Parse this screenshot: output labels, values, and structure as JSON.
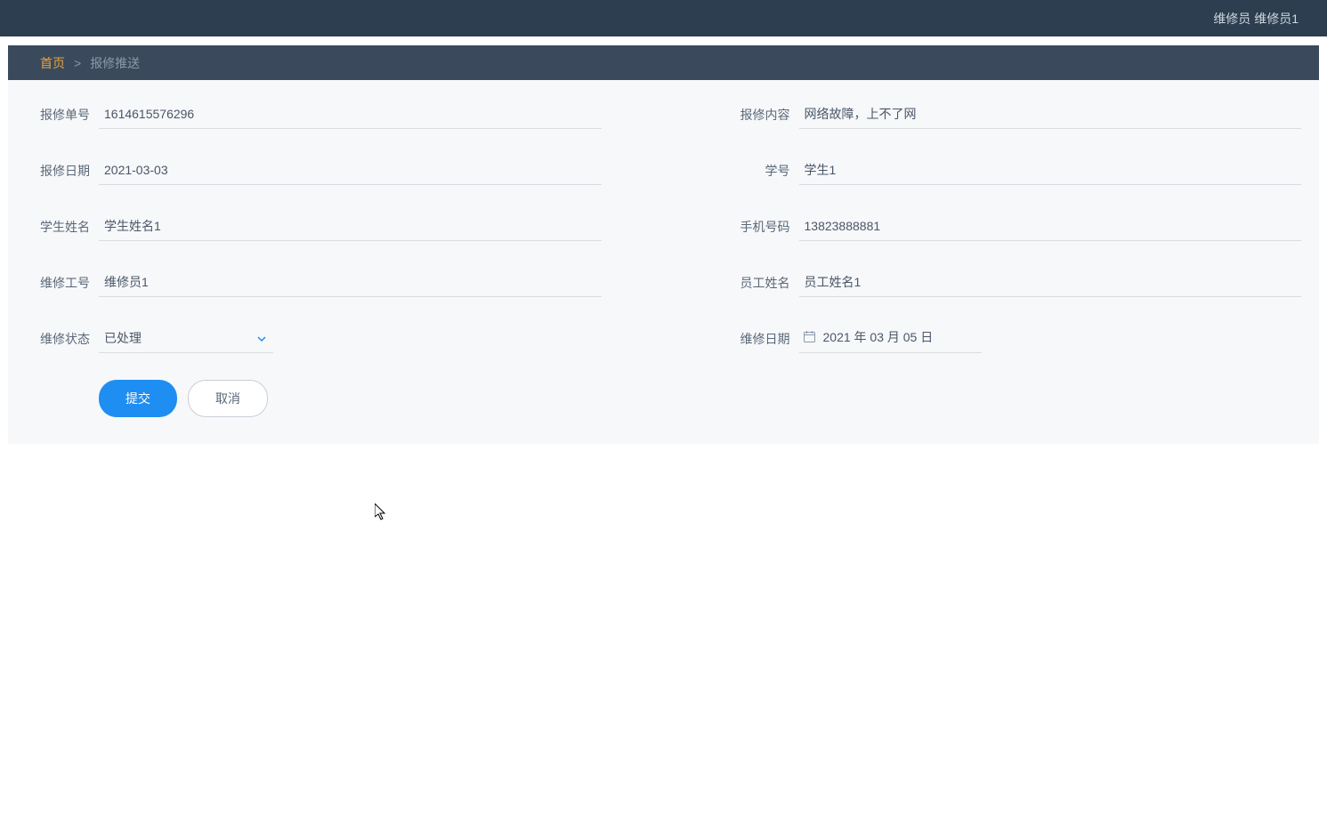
{
  "header": {
    "user_role": "维修员",
    "user_name": "维修员1"
  },
  "breadcrumb": {
    "home": "首页",
    "separator": ">",
    "current": "报修推送"
  },
  "form": {
    "repair_order_label": "报修单号",
    "repair_order_value": "1614615576296",
    "repair_content_label": "报修内容",
    "repair_content_value": "网络故障，上不了网",
    "repair_date_label": "报修日期",
    "repair_date_value": "2021-03-03",
    "student_id_label": "学号",
    "student_id_value": "学生1",
    "student_name_label": "学生姓名",
    "student_name_value": "学生姓名1",
    "phone_label": "手机号码",
    "phone_value": "13823888881",
    "worker_id_label": "维修工号",
    "worker_id_value": "维修员1",
    "employee_name_label": "员工姓名",
    "employee_name_value": "员工姓名1",
    "repair_status_label": "维修状态",
    "repair_status_value": "已处理",
    "maintenance_date_label": "维修日期",
    "maintenance_date_value": "2021 年 03 月 05 日"
  },
  "buttons": {
    "submit": "提交",
    "cancel": "取消"
  },
  "colors": {
    "header_bg": "#2c3e50",
    "breadcrumb_bg": "#3a4a5c",
    "accent_orange": "#e8a33d",
    "primary_blue": "#1f8ef3"
  }
}
